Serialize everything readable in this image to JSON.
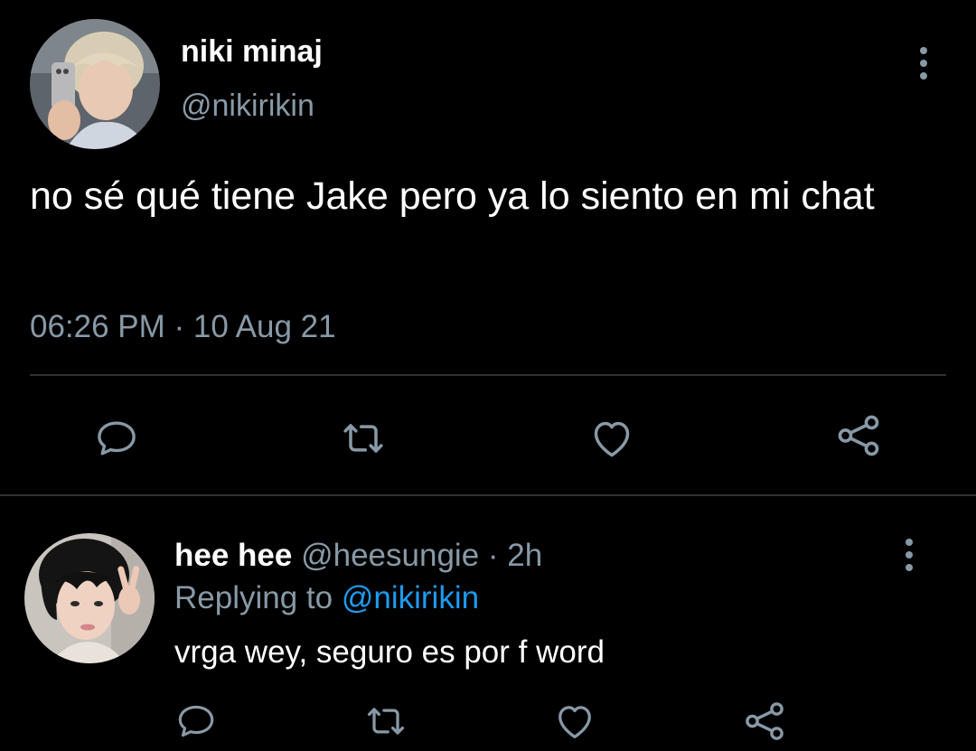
{
  "colors": {
    "background": "#000000",
    "text_primary": "#ffffff",
    "text_secondary": "#8899a6",
    "link": "#1d9bf0",
    "divider": "#2f3336",
    "icon": "#8899a6"
  },
  "main_tweet": {
    "display_name": "niki minaj",
    "handle": "@nikirikin",
    "text": "no sé qué tiene Jake pero ya lo siento en mi chat",
    "timestamp": "06:26 PM · 10 Aug 21",
    "more_icon": "more-vertical-icon",
    "actions": [
      "reply-icon",
      "retweet-icon",
      "like-icon",
      "share-icon"
    ]
  },
  "reply": {
    "display_name": "hee hee",
    "handle": "@heesungie",
    "separator": "·",
    "time": "2h",
    "replying_prefix": "Replying to",
    "replying_to": "@nikirikin",
    "text": "vrga wey, seguro es por f word",
    "more_icon": "more-vertical-icon",
    "actions": [
      "reply-icon",
      "retweet-icon",
      "like-icon",
      "share-icon"
    ]
  }
}
